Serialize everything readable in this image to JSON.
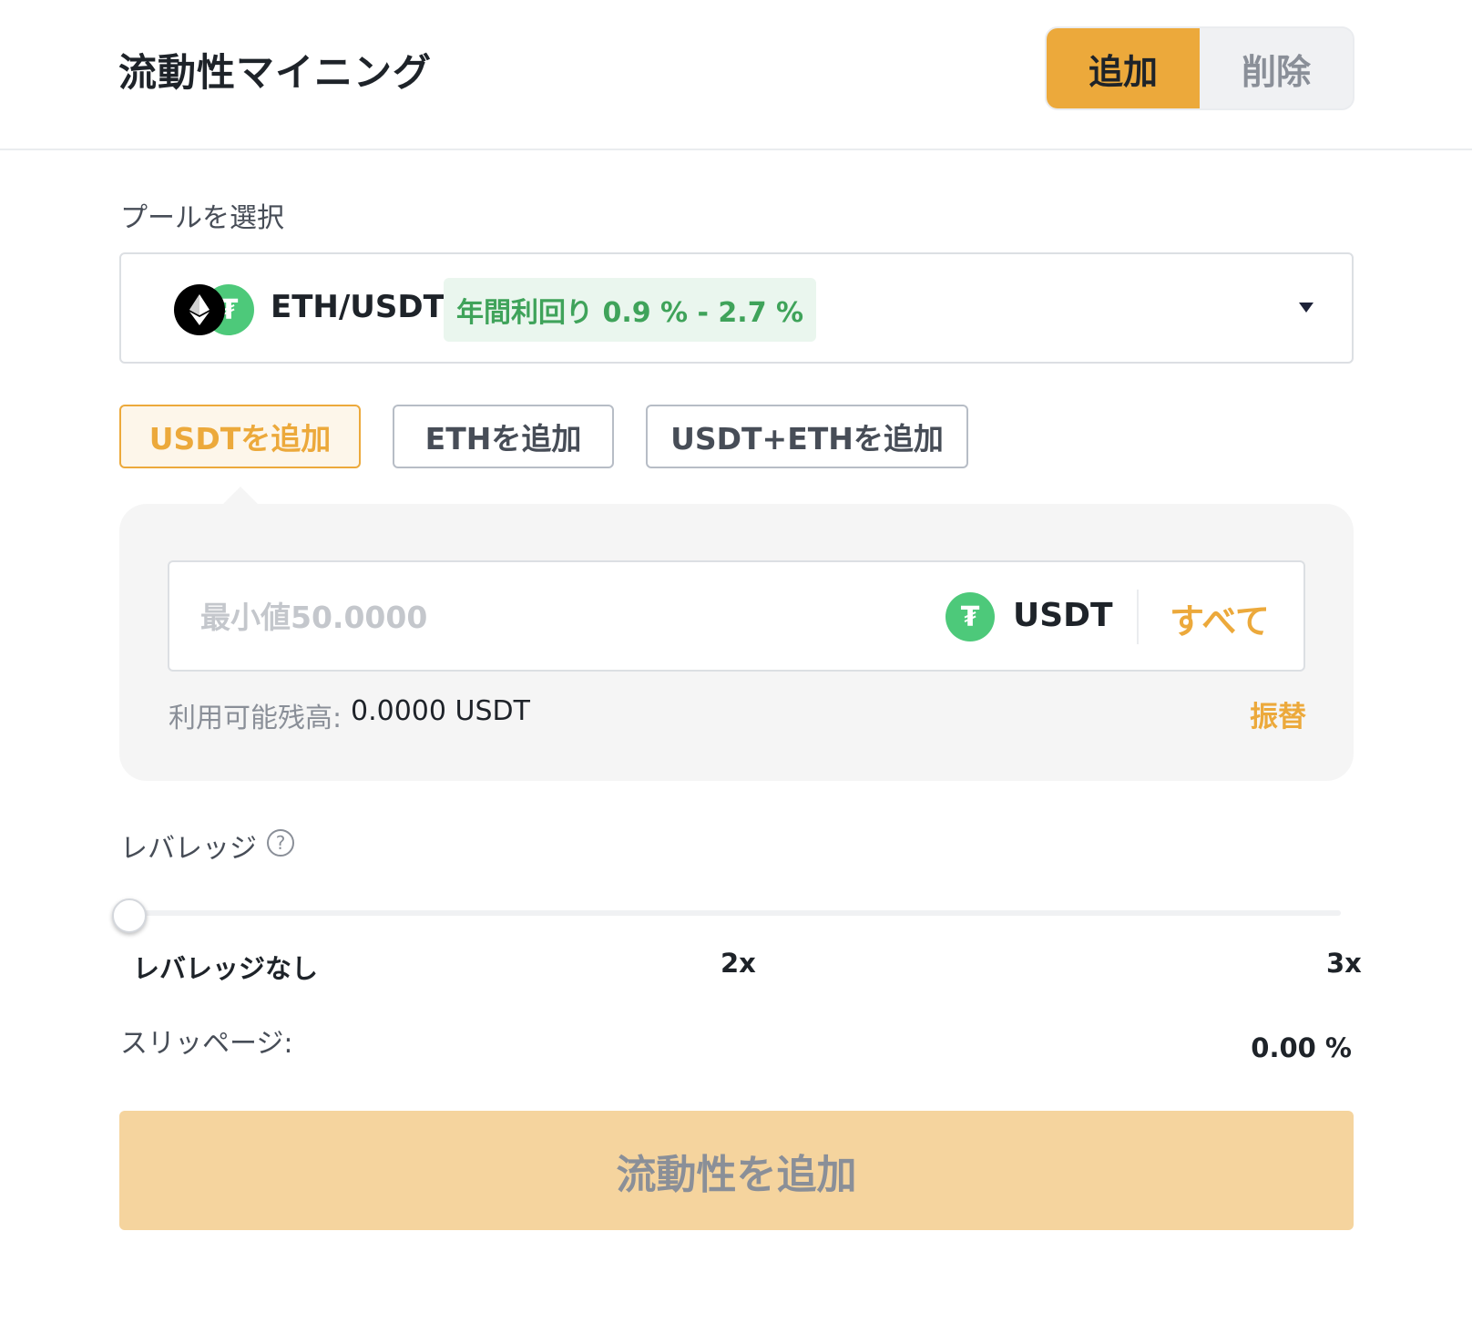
{
  "header": {
    "title": "流動性マイニング",
    "mode_add": "追加",
    "mode_remove": "削除"
  },
  "pool": {
    "label": "プールを選択",
    "pair": "ETH/USDT",
    "apy": "年間利回り 0.9 % - 2.7 %",
    "icons": [
      "eth-icon",
      "usdt-icon"
    ]
  },
  "add_tabs": [
    {
      "label": "USDTを追加",
      "selected": true
    },
    {
      "label": "ETHを追加",
      "selected": false
    },
    {
      "label": "USDT+ETHを追加",
      "selected": false
    }
  ],
  "amount": {
    "placeholder": "最小値50.0000",
    "value": "",
    "token": "USDT",
    "max_label": "すべて",
    "balance_label": "利用可能残高:",
    "balance_value": "0.0000 USDT",
    "transfer_label": "振替"
  },
  "leverage": {
    "label": "レバレッジ",
    "ticks": [
      "レバレッジなし",
      "2x",
      "3x"
    ],
    "value_fraction": 0
  },
  "slippage": {
    "label": "スリッページ:",
    "value": "0.00 %"
  },
  "submit": {
    "label": "流動性を追加"
  },
  "colors": {
    "accent": "#eca93b",
    "apy_text": "#3fa35a",
    "apy_bg": "#eaf6ee",
    "usdt_green": "#4dc97a",
    "submit_disabled_bg": "#f5d49e"
  }
}
